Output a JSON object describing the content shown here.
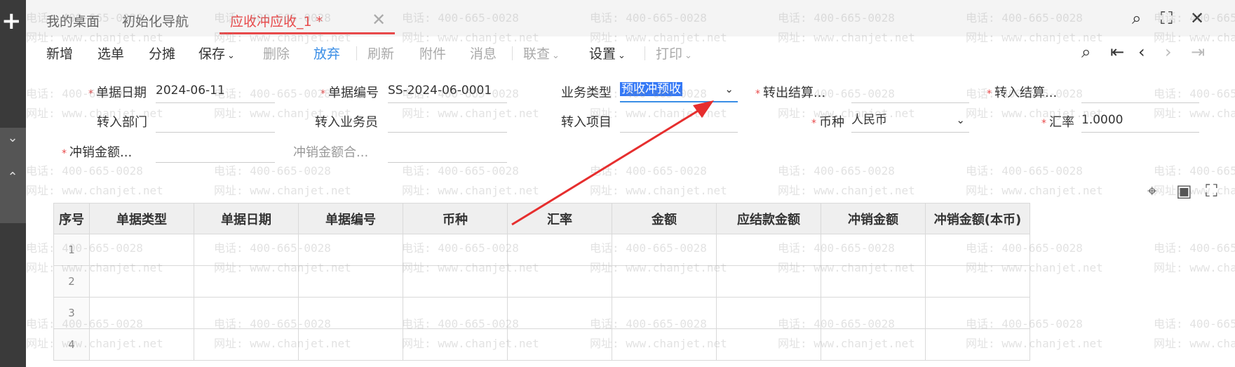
{
  "tabs": [
    {
      "label": "我的桌面"
    },
    {
      "label": "初始化导航"
    },
    {
      "label": "应收冲应收_1 *"
    }
  ],
  "toolbar": {
    "new": "新增",
    "select_doc": "选单",
    "allocate": "分摊",
    "save": "保存",
    "delete": "删除",
    "discard": "放弃",
    "refresh": "刷新",
    "attachment": "附件",
    "message": "消息",
    "link_query": "联查",
    "settings": "设置",
    "print": "打印"
  },
  "form": {
    "doc_date_label": "单据日期",
    "doc_date_value": "2024-06-11",
    "doc_no_label": "单据编号",
    "doc_no_value": "SS-2024-06-0001",
    "biz_type_label": "业务类型",
    "biz_type_value": "预收冲预收",
    "out_settle_label": "转出结算...",
    "in_settle_label": "转入结算...",
    "in_dept_label": "转入部门",
    "in_salesman_label": "转入业务员",
    "in_project_label": "转入项目",
    "currency_label": "币种",
    "currency_value": "人民币",
    "rate_label": "汇率",
    "rate_value": "1.0000",
    "writeoff_amount_label": "冲销金额...",
    "writeoff_total_label": "冲销金额合..."
  },
  "table": {
    "headers": [
      "序号",
      "单据类型",
      "单据日期",
      "单据编号",
      "币种",
      "汇率",
      "金额",
      "应结款金额",
      "冲销金额",
      "冲销金额(本币)"
    ],
    "rows": [
      "1",
      "2",
      "3",
      "4"
    ]
  },
  "watermark": {
    "phone": "电话: 400-665-0028",
    "site": "网址: www.chanjet.net"
  },
  "colors": {
    "accent_red": "#e8494a",
    "link_blue": "#3a8ee6",
    "selection_blue": "#3478f6"
  }
}
